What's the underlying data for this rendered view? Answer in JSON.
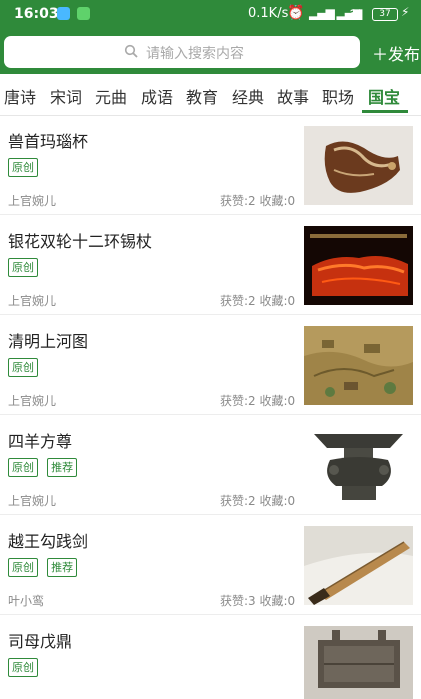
{
  "status_bar": {
    "time": "16:03",
    "speed": "0.1K/s",
    "battery": "37"
  },
  "search": {
    "placeholder": "请输入搜索内容"
  },
  "publish_label": "＋发布",
  "tabs": [
    {
      "label": "唐诗",
      "active": false
    },
    {
      "label": "宋词",
      "active": false
    },
    {
      "label": "元曲",
      "active": false
    },
    {
      "label": "成语",
      "active": false
    },
    {
      "label": "教育",
      "active": false
    },
    {
      "label": "经典",
      "active": false
    },
    {
      "label": "故事",
      "active": false
    },
    {
      "label": "职场",
      "active": false
    },
    {
      "label": "国宝",
      "active": true
    }
  ],
  "items": [
    {
      "title": "兽首玛瑙杯",
      "tags": [
        "原创"
      ],
      "author": "上官婉儿",
      "stats": "获赞:2 收藏:0",
      "image": "agate-rhyton"
    },
    {
      "title": "银花双轮十二环锡杖",
      "tags": [
        "原创"
      ],
      "author": "上官婉儿",
      "stats": "获赞:2 收藏:0",
      "image": "silver-staff"
    },
    {
      "title": "清明上河图",
      "tags": [
        "原创"
      ],
      "author": "上官婉儿",
      "stats": "获赞:2 收藏:0",
      "image": "qingming-scroll"
    },
    {
      "title": "四羊方尊",
      "tags": [
        "原创",
        "推荐"
      ],
      "author": "上官婉儿",
      "stats": "获赞:2 收藏:0",
      "image": "four-goat-zun"
    },
    {
      "title": "越王勾践剑",
      "tags": [
        "原创",
        "推荐"
      ],
      "author": "叶小鸾",
      "stats": "获赞:3 收藏:0",
      "image": "goujian-sword"
    },
    {
      "title": "司母戊鼎",
      "tags": [
        "原创"
      ],
      "author": "",
      "stats": "",
      "image": "simuwu-ding"
    }
  ],
  "colors": {
    "brand_green": "#2f8a3a"
  }
}
